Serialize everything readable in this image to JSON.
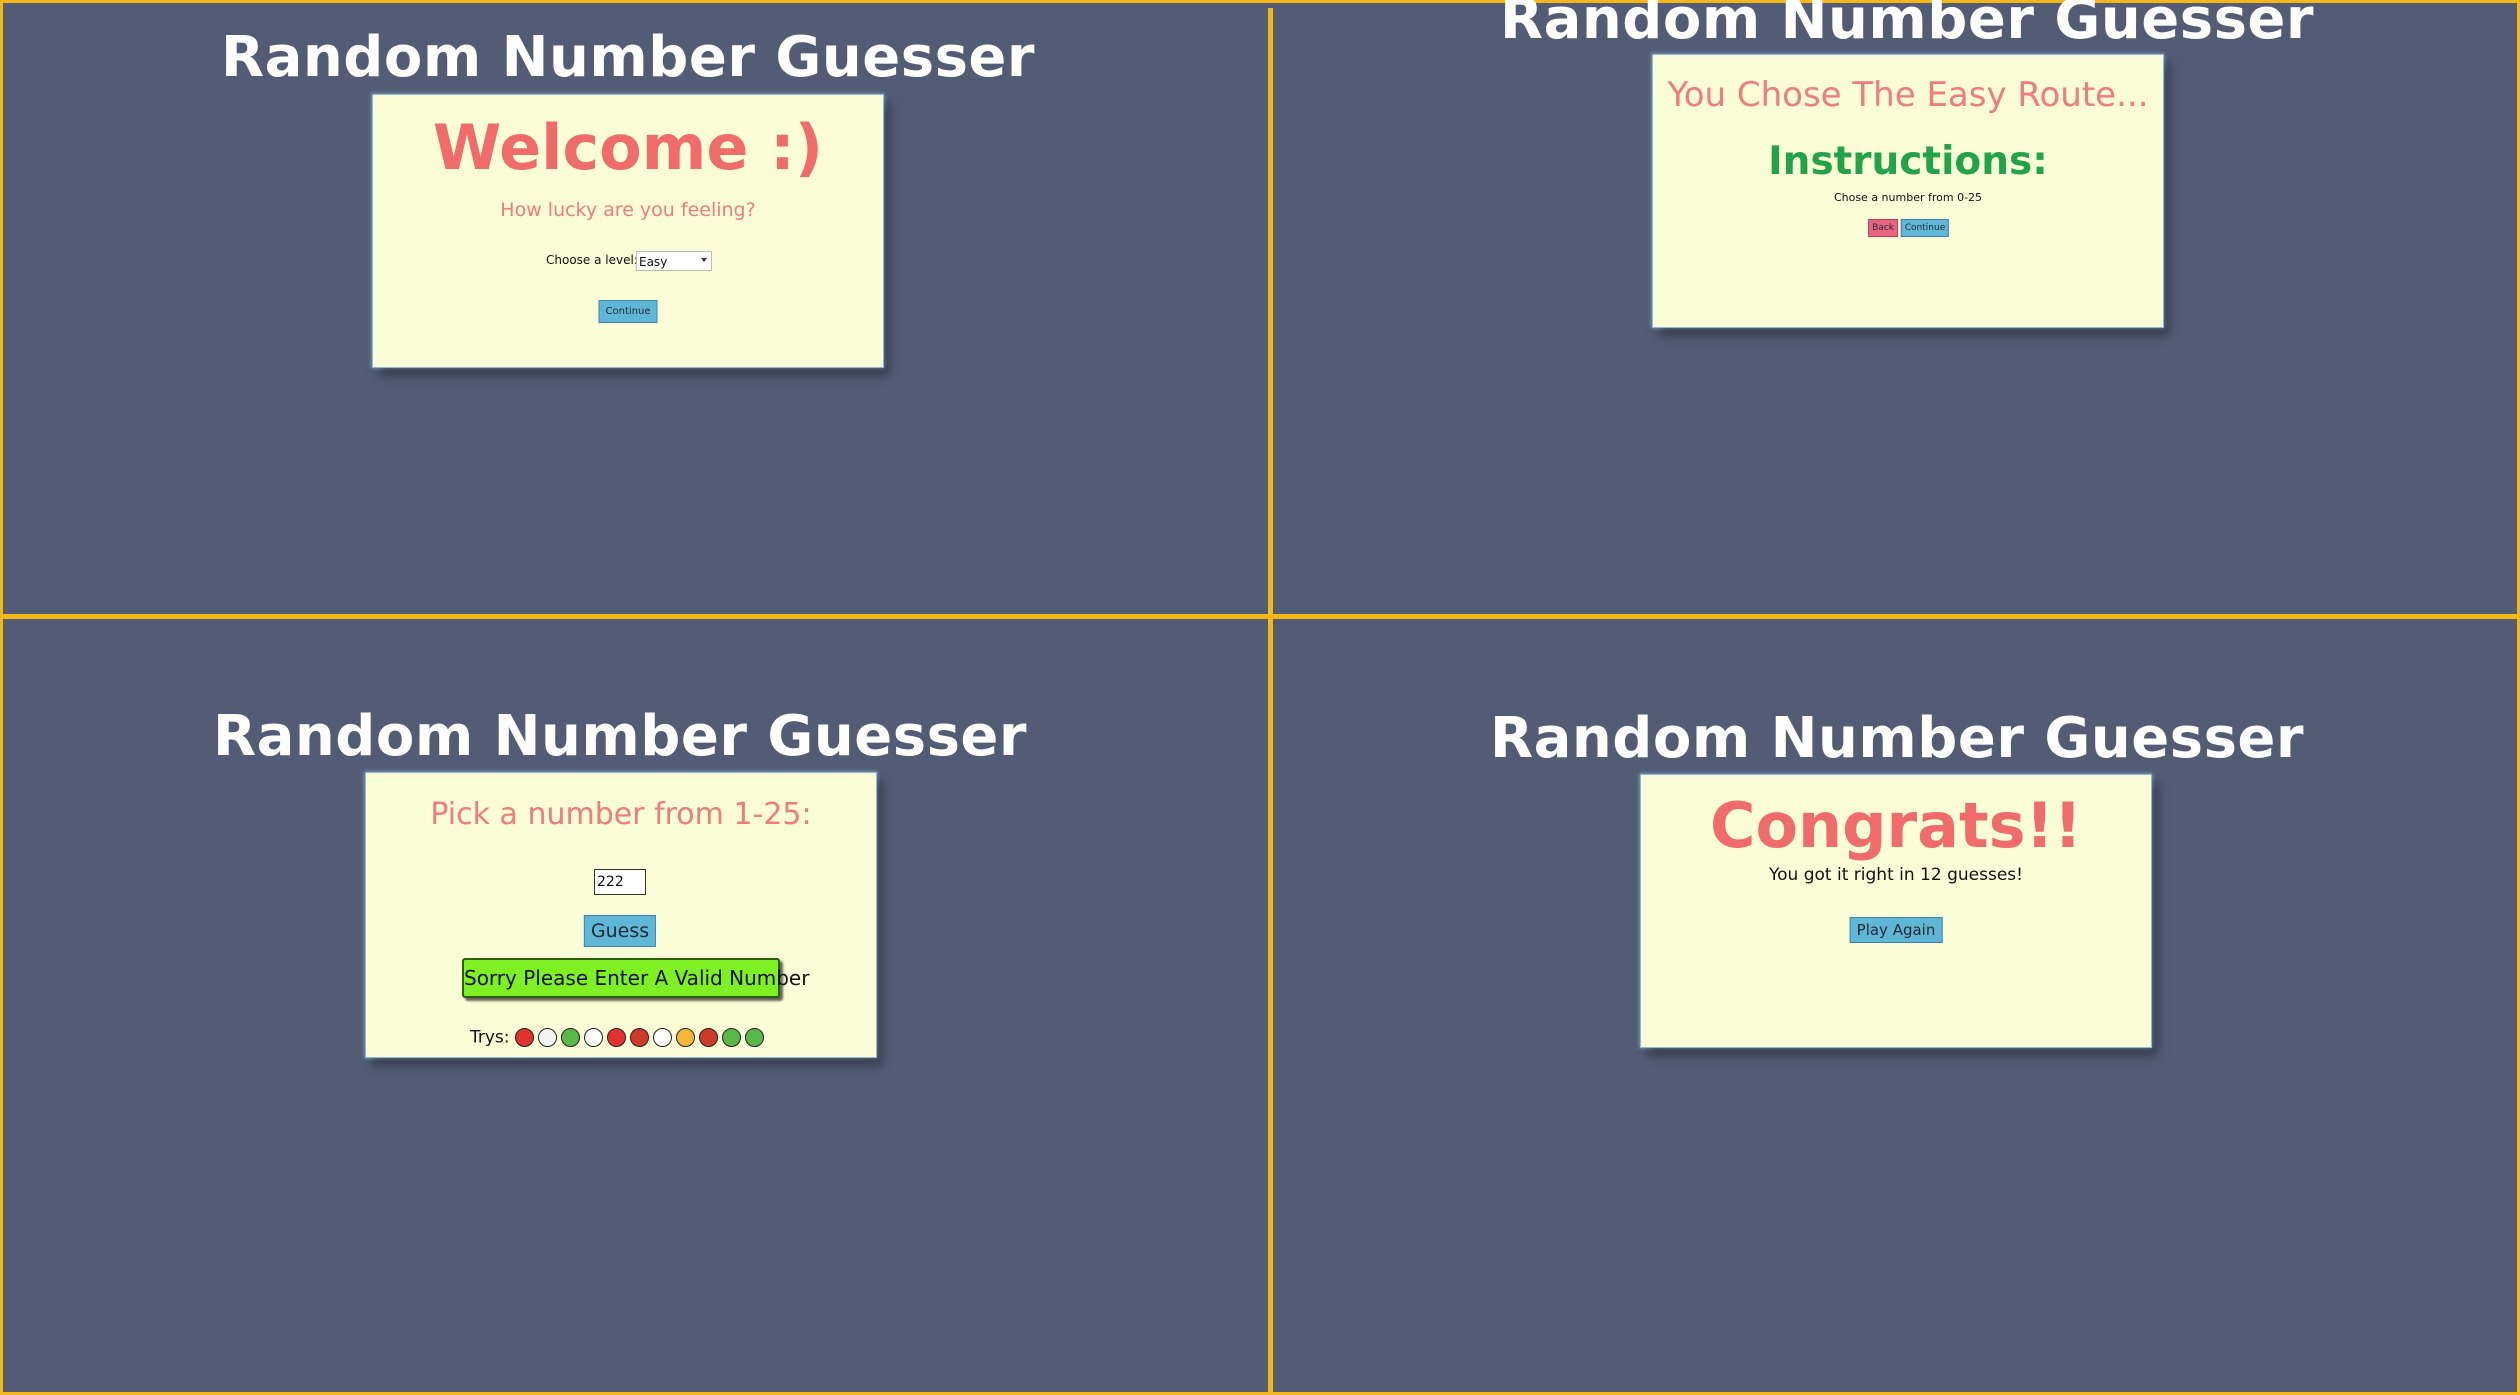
{
  "app_title": "Random Number Guesser",
  "colors": {
    "background": "#525d75",
    "divider": "#f5b617",
    "card": "#fbfdd6",
    "salmon": "#f06b6b",
    "green_heading": "#22a34a",
    "button": "#5fb6d6",
    "back_button": "#e86480",
    "error_button": "#7ef024"
  },
  "panel1": {
    "heading": "Welcome :)",
    "subheading": "How lucky are you feeling?",
    "level_label": "Choose a level:",
    "level_value": "Easy",
    "continue_label": "Continue"
  },
  "panel2": {
    "heading": "You Chose The Easy Route...",
    "instructions_title": "Instructions:",
    "instructions_text": "Chose a number from 0-25",
    "back_label": "Back",
    "continue_label": "Continue"
  },
  "panel3": {
    "heading": "Pick a number from 1-25:",
    "input_value": "222",
    "guess_label": "Guess",
    "error_label": "Sorry Please Enter A Valid Number",
    "trys_label": "Trys:",
    "try_icons": [
      "devil-face",
      "ghost",
      "zombie-face",
      "skull",
      "devil-face",
      "ogre-face",
      "skull",
      "cat-face",
      "ogre-face",
      "zombie-face",
      "zombie-face"
    ]
  },
  "panel4": {
    "heading": "Congrats!!",
    "message": "You got it right in 12 guesses!",
    "play_again_label": "Play Again"
  }
}
